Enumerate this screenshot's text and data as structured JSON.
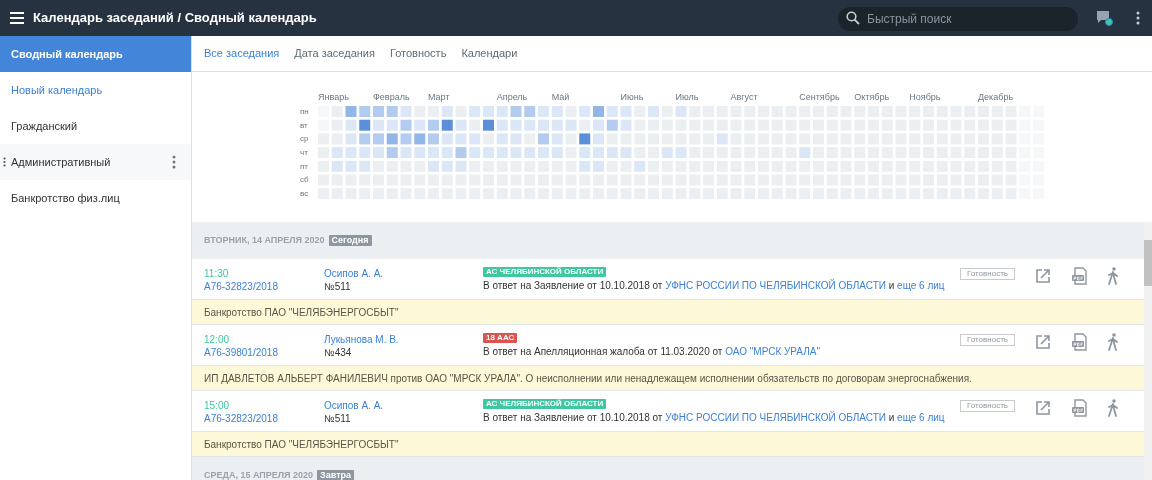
{
  "header": {
    "title": "Календарь заседаний / Сводный календарь",
    "search": {
      "placeholder": "Быстрый поиск"
    }
  },
  "sidebar": {
    "items": [
      {
        "label": "Сводный календарь",
        "kind": "calendar",
        "selected": true,
        "hovered": false
      },
      {
        "label": "Новый календарь",
        "kind": "action",
        "selected": false,
        "hovered": false
      },
      {
        "label": "Гражданский",
        "kind": "calendar",
        "selected": false,
        "hovered": false
      },
      {
        "label": "Административный",
        "kind": "calendar",
        "selected": false,
        "hovered": true
      },
      {
        "label": "Банкротство физ.лиц",
        "kind": "calendar",
        "selected": false,
        "hovered": false
      }
    ]
  },
  "tabs": [
    {
      "label": "Все заседания",
      "selected": true
    },
    {
      "label": "Дата заседания",
      "selected": false
    },
    {
      "label": "Готовность",
      "selected": false
    },
    {
      "label": "Календари",
      "selected": false
    }
  ],
  "heatmap": {
    "months": [
      "Январь",
      "Февраль",
      "Март",
      "Апрель",
      "Май",
      "Июнь",
      "Июль",
      "Август",
      "Сентябрь",
      "Октябрь",
      "Ноябрь",
      "Декабрь"
    ],
    "weekdays": [
      "пн",
      "вт",
      "ср",
      "чт",
      "пт",
      "сб",
      "вс"
    ]
  },
  "days": [
    {
      "date": "ВТОРНИК, 14 АПРЕЛЯ 2020",
      "badge": "Сегодня",
      "sessions": [
        {
          "time": "11:30",
          "case_number": "А76-32823/2018",
          "judge": "Осипов А. А.",
          "number": "№511",
          "court": {
            "label": "АС ЧЕЛЯБИНСКОЙ ОБЛАСТИ",
            "color": "#3ec7a1"
          },
          "description": [
            {
              "text": "В ответ на Заявление от 10.10.2018 от ",
              "kind": "text"
            },
            {
              "text": "УФНС РОССИИ ПО ЧЕЛЯБИНСКОЙ ОБЛАСТИ",
              "kind": "link"
            },
            {
              "text": " и ",
              "kind": "text"
            },
            {
              "text": "еще 6 лиц",
              "kind": "link"
            }
          ],
          "readiness": "Готовность",
          "note": "Банкротство ПАО \"ЧЕЛЯБЭНЕРГОСБЫТ\""
        },
        {
          "time": "12:00",
          "case_number": "А76-39801/2018",
          "judge": "Лукьянова М. В.",
          "number": "№434",
          "court": {
            "label": "18 ААС",
            "color": "#d9534f"
          },
          "description": [
            {
              "text": "В ответ на Апелляционная жалоба от 11.03.2020 от ",
              "kind": "text"
            },
            {
              "text": "ОАО \"МРСК УРАЛА\"",
              "kind": "link"
            }
          ],
          "readiness": "Готовность",
          "note": "ИП ДАВЛЕТОВ АЛЬБЕРТ ФАНИЛЕВИЧ против ОАО \"МРСК УРАЛА\". О неисполнении или ненадлежащем исполнении обязательств по договорам энергоснабжения."
        },
        {
          "time": "15:00",
          "case_number": "А76-32823/2018",
          "judge": "Осипов А. А.",
          "number": "№511",
          "court": {
            "label": "АС ЧЕЛЯБИНСКОЙ ОБЛАСТИ",
            "color": "#3ec7a1"
          },
          "description": [
            {
              "text": "В ответ на Заявление от 10.10.2018 от ",
              "kind": "text"
            },
            {
              "text": "УФНС РОССИИ ПО ЧЕЛЯБИНСКОЙ ОБЛАСТИ",
              "kind": "link"
            },
            {
              "text": " и ",
              "kind": "text"
            },
            {
              "text": "еще 6 лиц",
              "kind": "link"
            }
          ],
          "readiness": "Готовность",
          "note": "Банкротство ПАО \"ЧЕЛЯБЭНЕРГОСБЫТ\""
        }
      ]
    },
    {
      "date": "СРЕДА, 15 АПРЕЛЯ 2020",
      "badge": "Завтра"
    }
  ]
}
